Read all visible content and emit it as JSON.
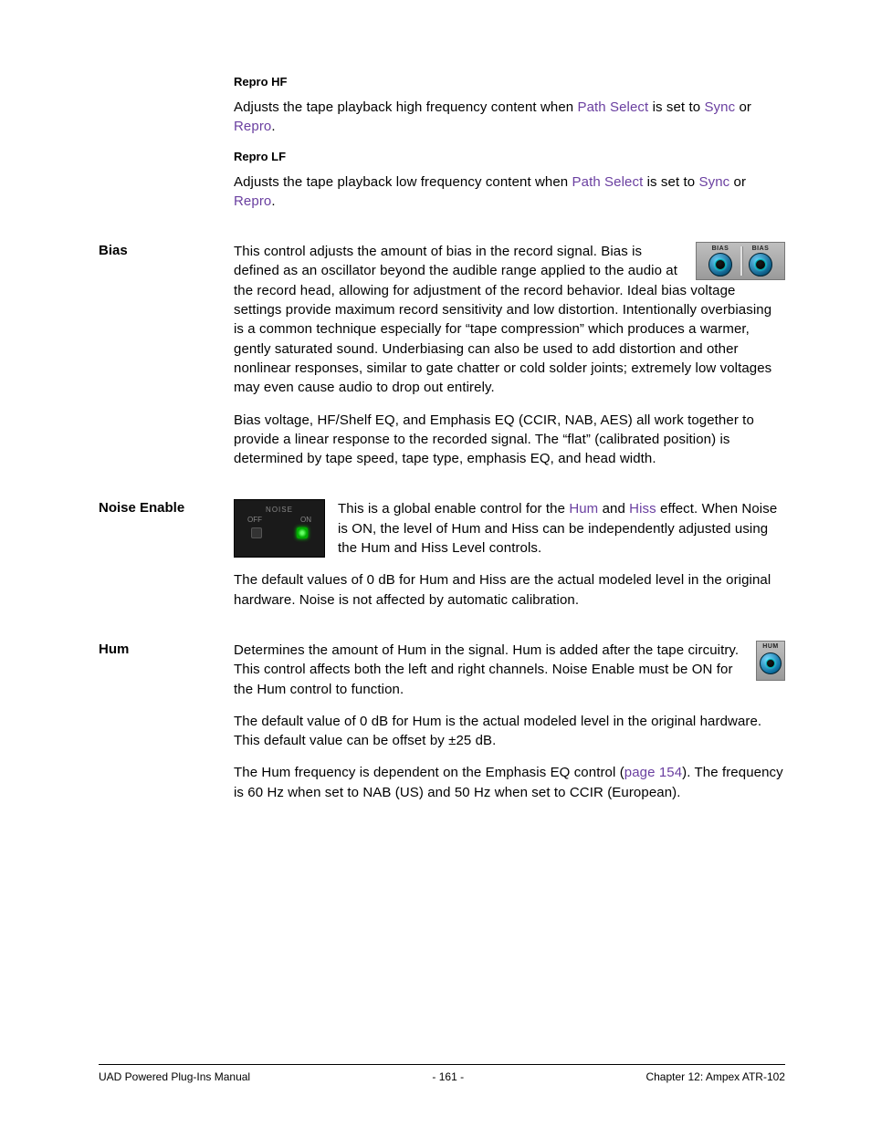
{
  "sections": {
    "repro_hf": {
      "heading": "Repro HF",
      "p1_a": "Adjusts the tape playback high frequency content when ",
      "p1_link1": "Path Select",
      "p1_b": " is set to ",
      "p1_link2": "Sync",
      "p1_c": " or ",
      "p1_link3": "Repro",
      "p1_d": "."
    },
    "repro_lf": {
      "heading": "Repro LF",
      "p1_a": "Adjusts the tape playback low frequency content when ",
      "p1_link1": "Path Select",
      "p1_b": " is set to ",
      "p1_link2": "Sync",
      "p1_c": " or ",
      "p1_link3": "Repro",
      "p1_d": "."
    },
    "bias": {
      "label": "Bias",
      "knob_label": "BIAS",
      "p1": "This control adjusts the amount of bias in the record signal. Bias is defined as an oscillator beyond the audible range applied to the audio at the record head, allowing for adjustment of the record behavior. Ideal bias voltage settings provide maximum record sensitivity and low distortion. Intentionally overbiasing is a common technique especially for “tape compression” which produces a warmer, gently saturated sound. Underbiasing can also be used to add distortion and other nonlinear responses, similar to gate chatter or cold solder joints; extremely low voltages may even cause audio to drop out entirely.",
      "p2": "Bias voltage, HF/Shelf EQ, and Emphasis EQ (CCIR, NAB, AES) all work together to provide a linear response to the recorded signal. The “flat” (calibrated position) is determined by tape speed, tape type, emphasis EQ, and head width."
    },
    "noise_enable": {
      "label": "Noise Enable",
      "fig_title": "NOISE",
      "fig_off": "OFF",
      "fig_on": "ON",
      "p1_a": "This is a global enable control for the ",
      "p1_link1": "Hum",
      "p1_b": " and ",
      "p1_link2": "Hiss",
      "p1_c": " effect. When Noise is ON, the level of Hum and Hiss can be independently adjusted using the Hum and Hiss Level controls.",
      "p2": "The default values of 0 dB for Hum and Hiss are the actual modeled level in the original hardware. Noise is not affected by automatic calibration."
    },
    "hum": {
      "label": "Hum",
      "knob_label": "HUM",
      "p1": "Determines the amount of Hum in the signal. Hum is added after the tape circuitry. This control affects both the left and right channels. Noise Enable must be ON for the Hum control to function.",
      "p2": "The default value of 0 dB for Hum is the actual modeled level in the original hardware. This default value can be offset by ±25 dB.",
      "p3_a": "The Hum frequency is dependent on the Emphasis EQ control (",
      "p3_link": "page 154",
      "p3_b": "). The frequency is 60 Hz when set to NAB (US) and 50 Hz when set to CCIR (European)."
    }
  },
  "footer": {
    "left": "UAD Powered Plug-Ins Manual",
    "center": "- 161 -",
    "right": "Chapter 12: Ampex ATR-102"
  }
}
